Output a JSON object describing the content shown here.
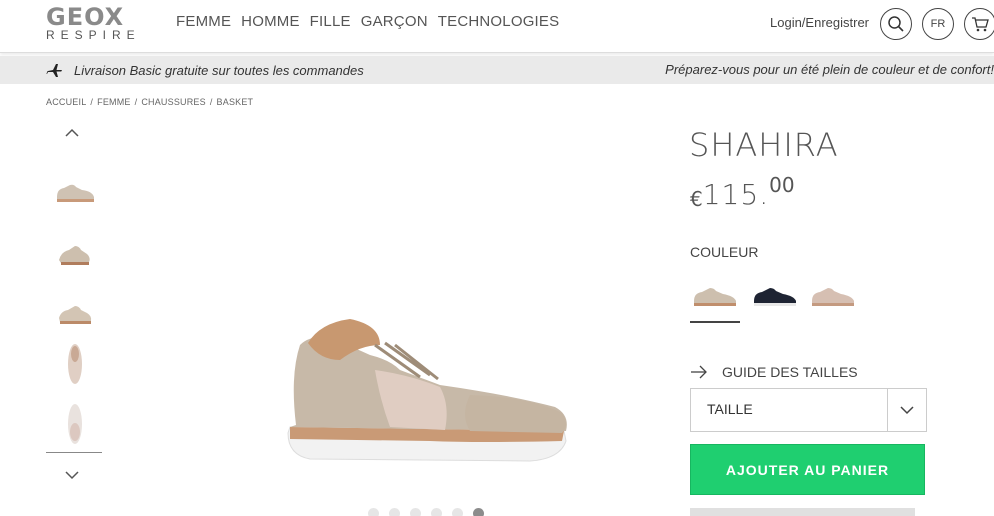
{
  "header": {
    "logo_main": "GEOX",
    "logo_sub": "RESPIRE",
    "nav": [
      "FEMME",
      "HOMME",
      "FILLE",
      "GARÇON",
      "TECHNOLOGIES"
    ],
    "login_label": "Login/Enregistrer",
    "language": "FR",
    "icons": [
      "search-icon",
      "cart-icon"
    ]
  },
  "promo": {
    "left_text": "Livraison Basic gratuite sur toutes les commandes",
    "right_text": "Préparez-vous pour un été plein de couleur et de confort!",
    "icon": "airplane-icon"
  },
  "breadcrumb": [
    "ACCUEIL",
    "/",
    "FEMME",
    "/",
    "CHAUSSURES",
    "/",
    "BASKET"
  ],
  "product": {
    "name": "SHAHIRA",
    "currency": "€",
    "price_int": "115",
    "price_sep": ".",
    "price_dec": "00",
    "color_label": "COULEUR",
    "swatches": [
      "beige-rose",
      "navy",
      "rose-gold"
    ],
    "size_guide_label": "GUIDE DES TAILLES",
    "size_placeholder": "TAILLE",
    "add_to_cart_label": "AJOUTER AU PANIER"
  },
  "gallery": {
    "thumbnail_count": 5,
    "dot_count": 6,
    "active_dot": 6
  },
  "colors": {
    "accent": "#1fcf70",
    "promo_bg": "#eaeaea"
  }
}
